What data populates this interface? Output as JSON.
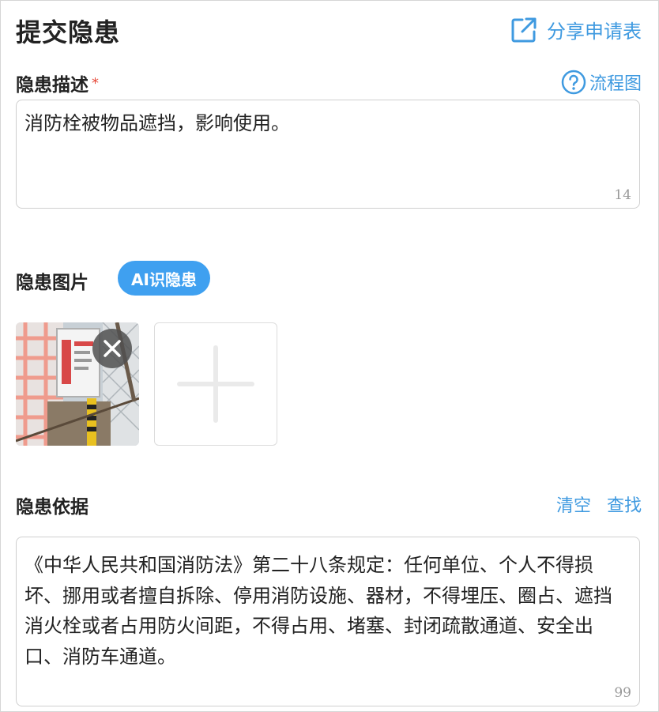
{
  "header": {
    "title": "提交隐患",
    "share_label": "分享申请表",
    "share_icon": "external-link-icon"
  },
  "description": {
    "label": "隐患描述",
    "required_mark": "*",
    "flow_label": "流程图",
    "flow_icon": "question-circle-icon",
    "value": "消防栓被物品遮挡，影响使用。",
    "count": "14"
  },
  "images": {
    "label": "隐患图片",
    "ai_button_label": "AI识隐患",
    "remove_icon": "close-icon",
    "add_icon": "plus-icon"
  },
  "basis": {
    "label": "隐患依据",
    "clear_label": "清空",
    "search_label": "查找",
    "value": "《中华人民共和国消防法》第二十八条规定：任何单位、个人不得损坏、挪用或者擅自拆除、停用消防设施、器材，不得埋压、圈占、遮挡消火栓或者占用防火间距，不得占用、堵塞、封闭疏散通道、安全出口、消防车通道。",
    "count": "99"
  },
  "colors": {
    "accent": "#3f9ae0",
    "badge": "#3fa0f0",
    "required": "#e74c3c"
  }
}
